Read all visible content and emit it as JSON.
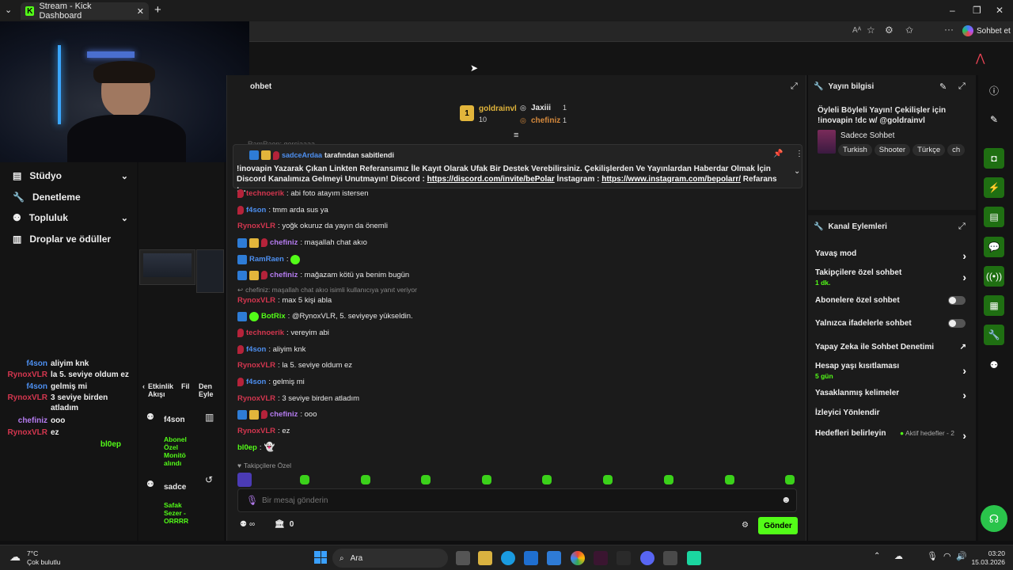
{
  "browser": {
    "tab_title": "Stream - Kick Dashboard",
    "new_tab": "+",
    "copilot_label": "Sohbet et"
  },
  "sidebar": {
    "items": [
      {
        "label": "Stüdyo",
        "has_chevron": true
      },
      {
        "label": "Denetleme",
        "has_chevron": false
      },
      {
        "label": "Topluluk",
        "has_chevron": true
      },
      {
        "label": "Droplar ve ödüller",
        "has_chevron": false
      }
    ]
  },
  "mini_chat": [
    {
      "user": "f4son",
      "msg": "aliyim knk",
      "color": "#4d8ff0"
    },
    {
      "user": "RynoxVLR",
      "msg": "la 5. seviye oldum ez",
      "color": "#d4364f"
    },
    {
      "user": "f4son",
      "msg": "gelmiş mi",
      "color": "#4d8ff0"
    },
    {
      "user": "RynoxVLR",
      "msg": "3 seviye birden atladım",
      "color": "#d4364f"
    },
    {
      "user": "chefiniz",
      "msg": "ooo",
      "color": "#b57cf0"
    },
    {
      "user": "RynoxVLR",
      "msg": "ez",
      "color": "#d4364f"
    },
    {
      "user": "bl0ep",
      "msg": "",
      "color": "#53fc18"
    }
  ],
  "activity": {
    "title": "Etkinlik Akışı",
    "filter": "Fil",
    "title2": "Den Eyle",
    "events": [
      {
        "user": "f4son",
        "text": "Abonel Özel Monitö alındı"
      },
      {
        "user": "sadce",
        "text": "Safak Sezer - ORRRR"
      }
    ]
  },
  "chat": {
    "title": "ohbet",
    "leaderboard": {
      "first": {
        "rank": "1",
        "user": "goldrainvl",
        "count": "10"
      },
      "second": {
        "user": "Jaxiii",
        "count": "1"
      },
      "third": {
        "user": "chefiniz",
        "count": "1"
      }
    },
    "partial_top": "RamRaen: gerçiaaaa",
    "pinned": {
      "by_user": "sadceArdaa",
      "by_text": "tarafından sabitlendi",
      "body_1": "!inovapin Yazarak Çıkan Linkten Referansımız İle Kayıt Olarak Ufak Bir Destek Verebilirsiniz. Çekilişlerden Ve Yayınlardan Haberdar Olmak İçin Discord Kanalımıza Gelmeyi Unutmayın! Discord : ",
      "link_1": "https://discord.com/invite/bePolar",
      "body_2": " İnstagram : ",
      "link_2": "https://www.instagram.com/bepolarr/",
      "body_3": " Refarans :..."
    },
    "messages": [
      {
        "user": "technoerik",
        "text": ": abi foto atayım istersen",
        "color": "#d4364f",
        "badges": [
          "red"
        ]
      },
      {
        "user": "f4son",
        "text": ": tmm arda sus ya",
        "color": "#4d8ff0",
        "badges": [
          "red"
        ]
      },
      {
        "user": "RynoxVLR",
        "text": ": yoğk okuruz da yayın da önemli",
        "color": "#d4364f",
        "badges": []
      },
      {
        "user": "chefiniz",
        "text": ": maşallah chat akıo",
        "color": "#b57cf0",
        "badges": [
          "blue",
          "gold",
          "red"
        ]
      },
      {
        "user": "RamRaen",
        "text": ":",
        "color": "#4d8ff0",
        "badges": [
          "blue"
        ]
      },
      {
        "user": "chefiniz",
        "text": ": mağazam kötü ya benim bugün",
        "color": "#b57cf0",
        "badges": [
          "blue",
          "gold",
          "red"
        ]
      },
      {
        "user": "RynoxVLR",
        "text": ": max 5 kişi abla",
        "color": "#d4364f",
        "badges": []
      },
      {
        "user": "BotRix",
        "text": ": @RynoxVLR, 5. seviyeye yükseldin.",
        "color": "#53fc18",
        "badges": [
          "blue",
          "green"
        ]
      },
      {
        "user": "technoerik",
        "text": ": vereyim abi",
        "color": "#d4364f",
        "badges": [
          "red"
        ]
      },
      {
        "user": "f4son",
        "text": ": aliyim knk",
        "color": "#4d8ff0",
        "badges": [
          "red"
        ]
      },
      {
        "user": "RynoxVLR",
        "text": ": la 5. seviye oldum ez",
        "color": "#d4364f",
        "badges": []
      },
      {
        "user": "f4son",
        "text": ": gelmiş mi",
        "color": "#4d8ff0",
        "badges": [
          "red"
        ]
      },
      {
        "user": "RynoxVLR",
        "text": ": 3 seviye birden atladım",
        "color": "#d4364f",
        "badges": []
      },
      {
        "user": "chefiniz",
        "text": ": ooo",
        "color": "#b57cf0",
        "badges": [
          "blue",
          "gold",
          "red"
        ]
      },
      {
        "user": "RynoxVLR",
        "text": ": ez",
        "color": "#d4364f",
        "badges": []
      },
      {
        "user": "bl0ep",
        "text": ":",
        "color": "#53fc18",
        "badges": []
      }
    ],
    "reply_note": "chefiniz: maşallah chat akıo isimli kullanıcıya yanıt veriyor",
    "followers_only": "Takipçilere Özel",
    "input_placeholder": "Bir mesaj gönderin",
    "points_label": "∞",
    "gift_count": "0",
    "send_label": "Gönder"
  },
  "stream_info": {
    "title": "Yayın bilgisi",
    "stream_title": "Öyleli Böyleli Yayın! Çekilişler için !inovapin !dc w/ @goldrainvl",
    "category": "Sadece Sohbet",
    "tags": [
      "Turkish",
      "Shooter",
      "Türkçe",
      "ch"
    ]
  },
  "channel_actions": {
    "title": "Kanal Eylemleri",
    "items": [
      {
        "label": "Yavaş mod",
        "sub": "",
        "control": "arrow"
      },
      {
        "label": "Takipçilere özel sohbet",
        "sub": "1 dk.",
        "control": "arrow"
      },
      {
        "label": "Abonelere özel sohbet",
        "sub": "",
        "control": "toggle"
      },
      {
        "label": "Yalnızca ifadelerle sohbet",
        "sub": "",
        "control": "toggle"
      },
      {
        "label": "Yapay Zeka ile Sohbet Denetimi",
        "sub": "",
        "control": "external"
      },
      {
        "label": "Hesap yaşı kısıtlaması",
        "sub": "5 gün",
        "control": "arrow"
      },
      {
        "label": "Yasaklanmış kelimeler",
        "sub": "",
        "control": "arrow"
      },
      {
        "label": "İzleyici Yönlendir",
        "sub": "",
        "control": "none"
      },
      {
        "label": "Hedefleri belirleyin",
        "sub": "",
        "control": "arrow",
        "extra": "Aktif hedefler - 2"
      }
    ]
  },
  "taskbar": {
    "temp": "7°C",
    "weather": "Çok bulutlu",
    "search": "Ara",
    "time": "03:20",
    "date": "15.03.2026"
  }
}
